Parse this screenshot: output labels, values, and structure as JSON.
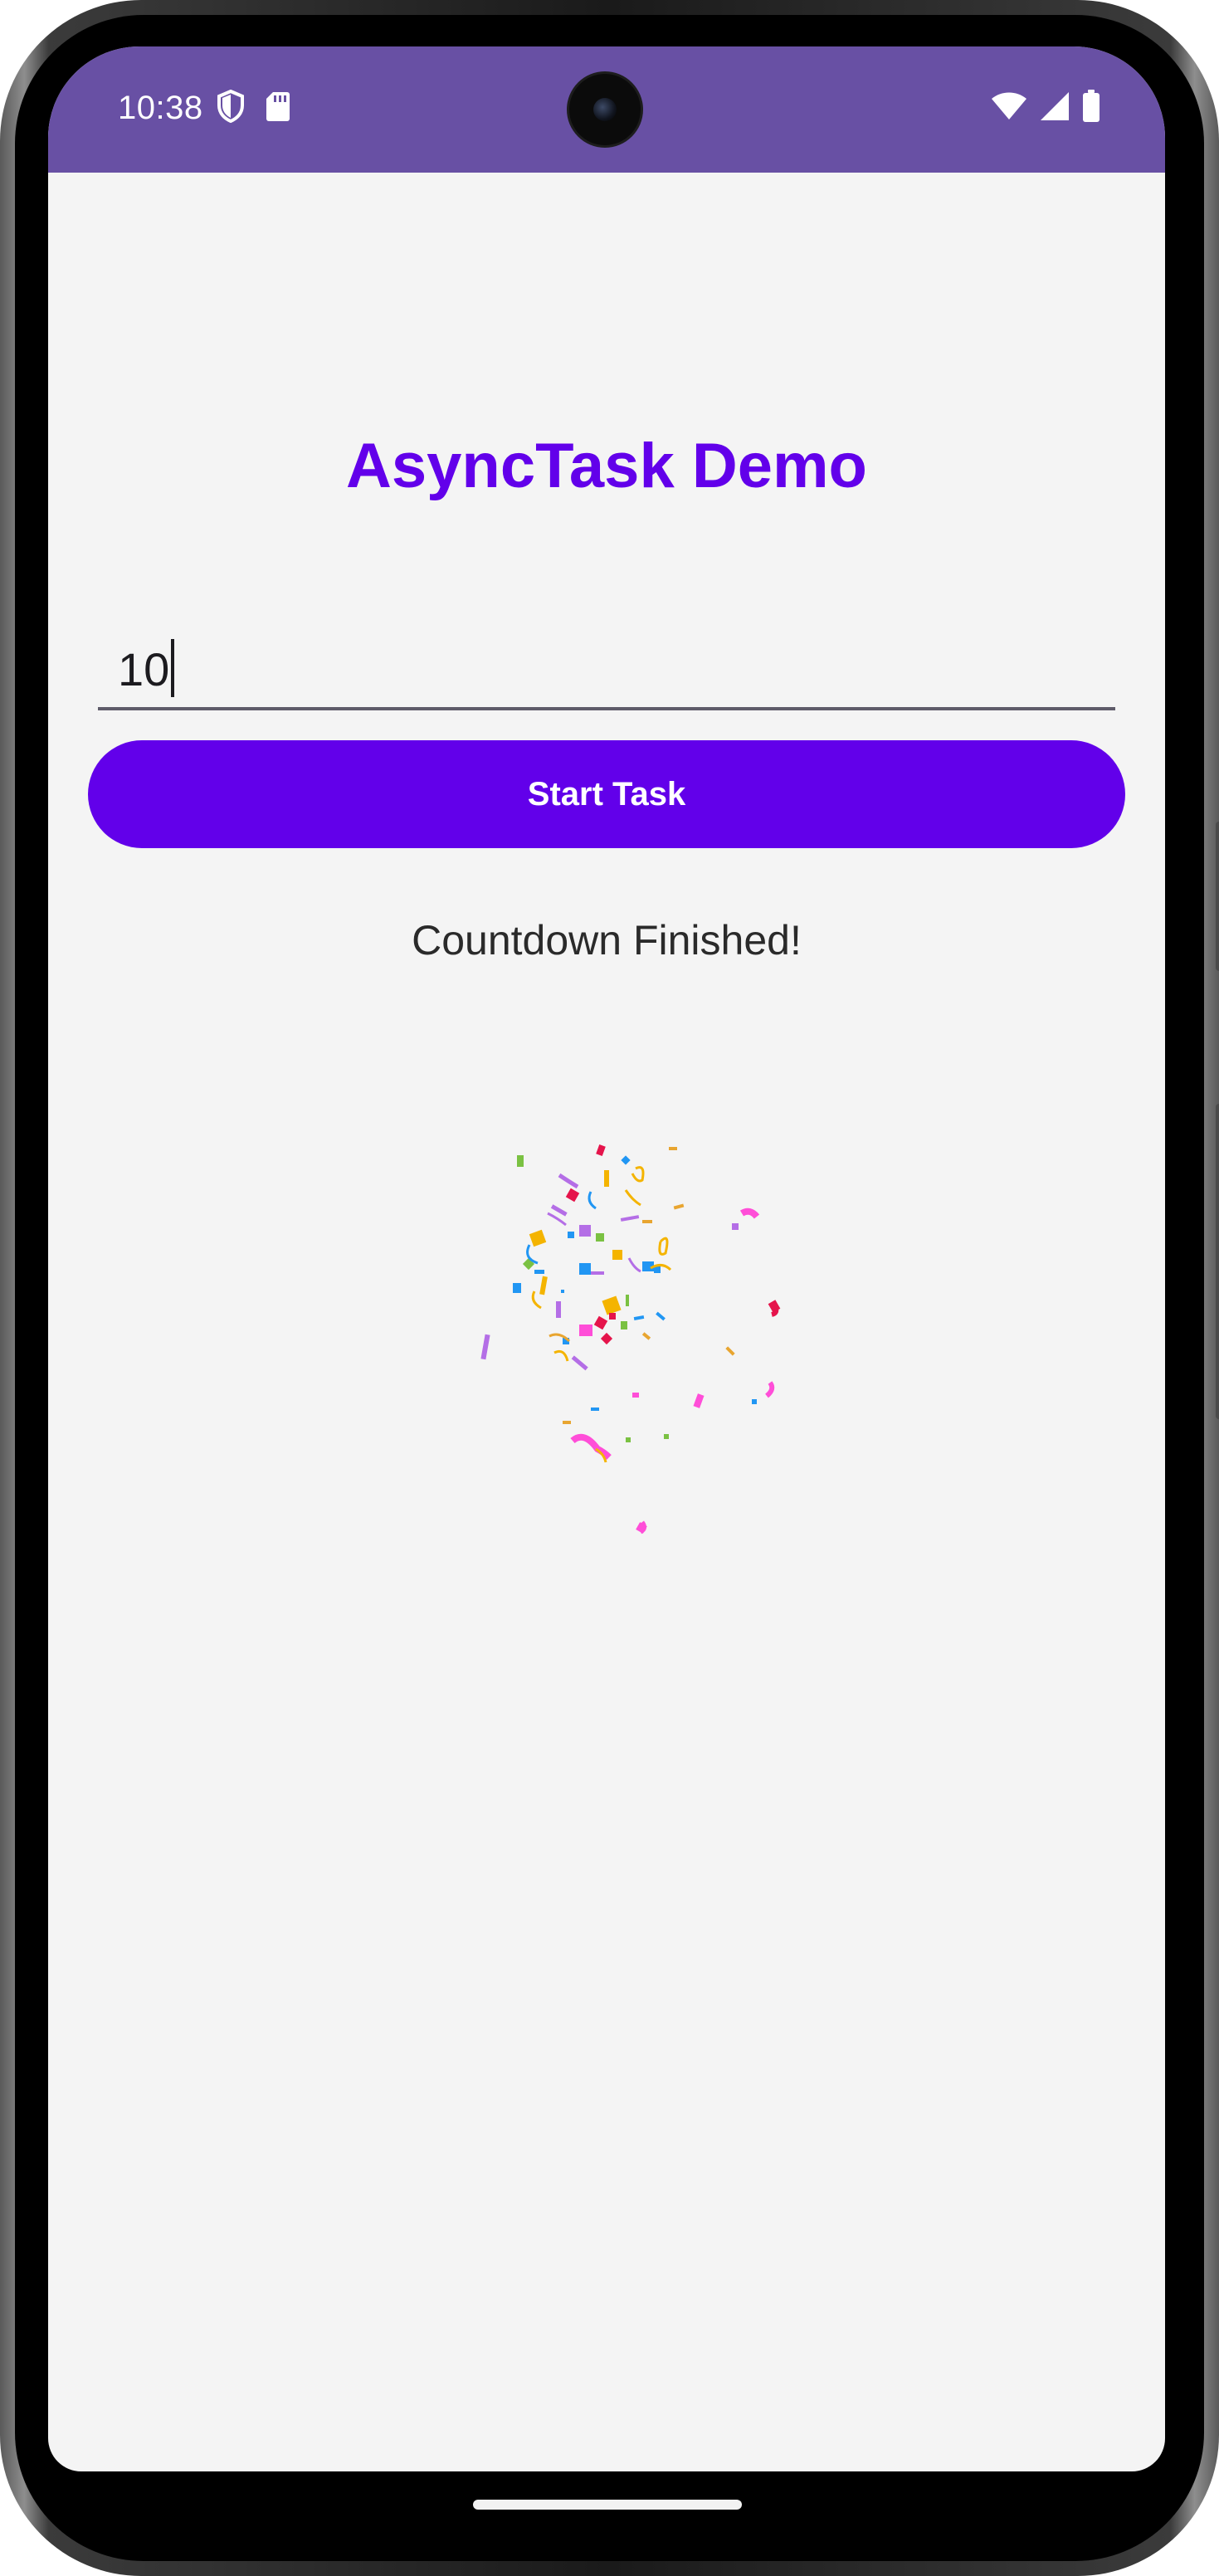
{
  "status_bar": {
    "time": "10:38",
    "left_icons": [
      "shield-icon",
      "sd-card-icon"
    ],
    "right_icons": [
      "wifi-icon",
      "cellular-signal-icon",
      "battery-icon"
    ],
    "background": "#6850a4"
  },
  "app": {
    "title": "AsyncTask Demo",
    "title_color": "#6200ea",
    "input": {
      "value": "10"
    },
    "start_button": {
      "label": "Start Task",
      "color": "#6200ea"
    },
    "status_message": "Countdown Finished!",
    "animation": "confetti"
  }
}
